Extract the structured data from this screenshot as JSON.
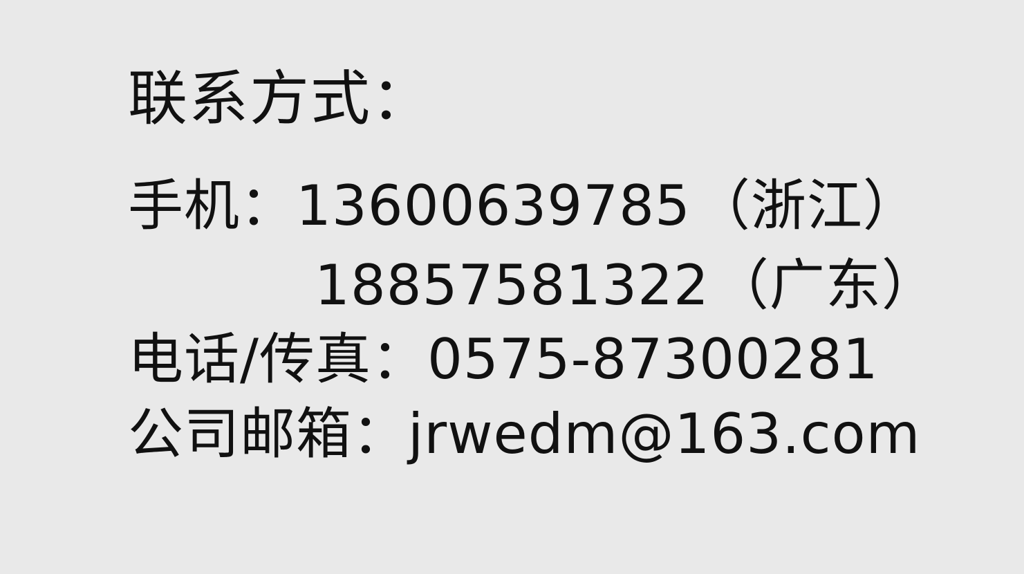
{
  "contact": {
    "heading": "联系方式：",
    "mobile": {
      "label": "手机：",
      "entries": [
        {
          "number": "13600639785",
          "region": "（浙江）"
        },
        {
          "number": "18857581322",
          "region": "（广东）"
        }
      ]
    },
    "phone_fax": {
      "label": "电话/传真：",
      "number": "0575-87300281"
    },
    "email": {
      "label": "公司邮箱：",
      "address": "jrwedm@163.com"
    }
  }
}
